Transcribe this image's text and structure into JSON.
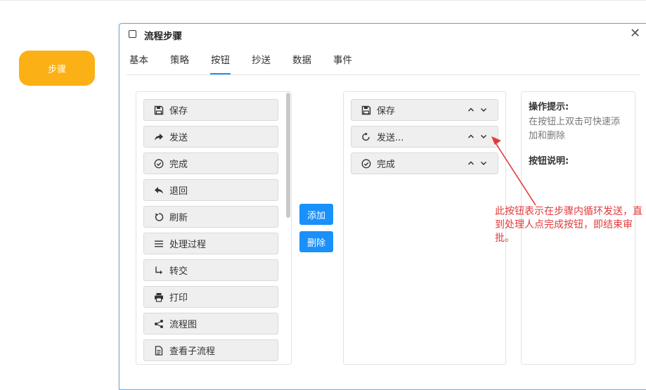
{
  "canvas": {
    "step_node_label": "步骤"
  },
  "dialog": {
    "title": "流程步骤",
    "close_glyph": "✕",
    "tabs": [
      {
        "label": "基本"
      },
      {
        "label": "策略"
      },
      {
        "label": "按钮",
        "active": true
      },
      {
        "label": "抄送"
      },
      {
        "label": "数据"
      },
      {
        "label": "事件"
      }
    ]
  },
  "available_buttons": [
    {
      "label": "保存",
      "icon": "save-icon"
    },
    {
      "label": "发送",
      "icon": "share-icon"
    },
    {
      "label": "完成",
      "icon": "check-circle-icon"
    },
    {
      "label": "退回",
      "icon": "reply-icon"
    },
    {
      "label": "刷新",
      "icon": "refresh-icon"
    },
    {
      "label": "处理过程",
      "icon": "list-icon"
    },
    {
      "label": "转交",
      "icon": "forward-arrow-icon"
    },
    {
      "label": "打印",
      "icon": "print-icon"
    },
    {
      "label": "流程图",
      "icon": "network-icon"
    },
    {
      "label": "查看子流程",
      "icon": "document-icon"
    }
  ],
  "actions": {
    "add_label": "添加",
    "delete_label": "删除"
  },
  "selected_buttons": [
    {
      "label": "保存",
      "icon": "save-icon"
    },
    {
      "label": "发送...",
      "icon": "loop-icon"
    },
    {
      "label": "完成",
      "icon": "check-circle-icon"
    }
  ],
  "help": {
    "tips_title": "操作提示:",
    "tips_text": "在按钮上双击可快速添加和删除",
    "desc_title": "按钮说明:"
  },
  "annotation": {
    "text": "此按钮表示在步骤内循环发送，直到处理人点完成按钮，即结束审批。",
    "color": "#e23a3a"
  },
  "colors": {
    "accent": "#1990fa",
    "step_node": "#fbb015"
  }
}
